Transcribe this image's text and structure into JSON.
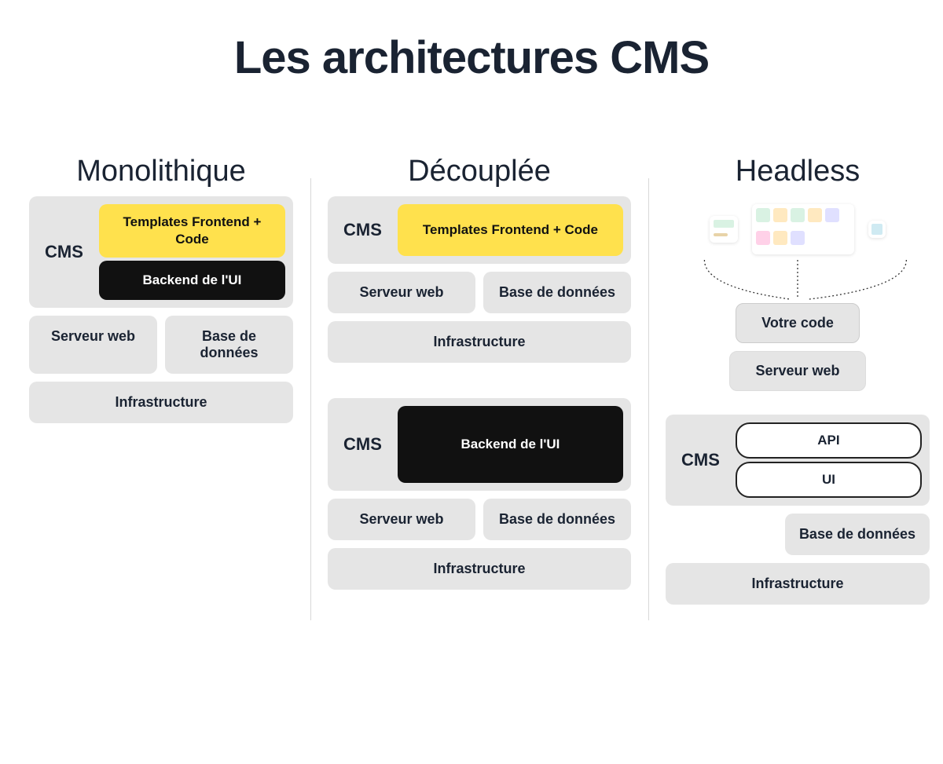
{
  "title": "Les architectures CMS",
  "columns": {
    "mono": {
      "title": "Monolithique",
      "cms_label": "CMS",
      "templates": "Templates Frontend + Code",
      "backend": "Backend de l'UI",
      "web": "Serveur web",
      "db": "Base de données",
      "infra": "Infrastructure"
    },
    "decoupled": {
      "title": "Découplée",
      "cms_label": "CMS",
      "templates": "Templates Frontend + Code",
      "backend": "Backend de l'UI",
      "web": "Serveur web",
      "db": "Base de données",
      "infra": "Infrastructure"
    },
    "headless": {
      "title": "Headless",
      "your_code": "Votre code",
      "web": "Serveur web",
      "cms_label": "CMS",
      "api": "API",
      "ui": "UI",
      "db": "Base de données",
      "infra": "Infrastructure"
    }
  }
}
